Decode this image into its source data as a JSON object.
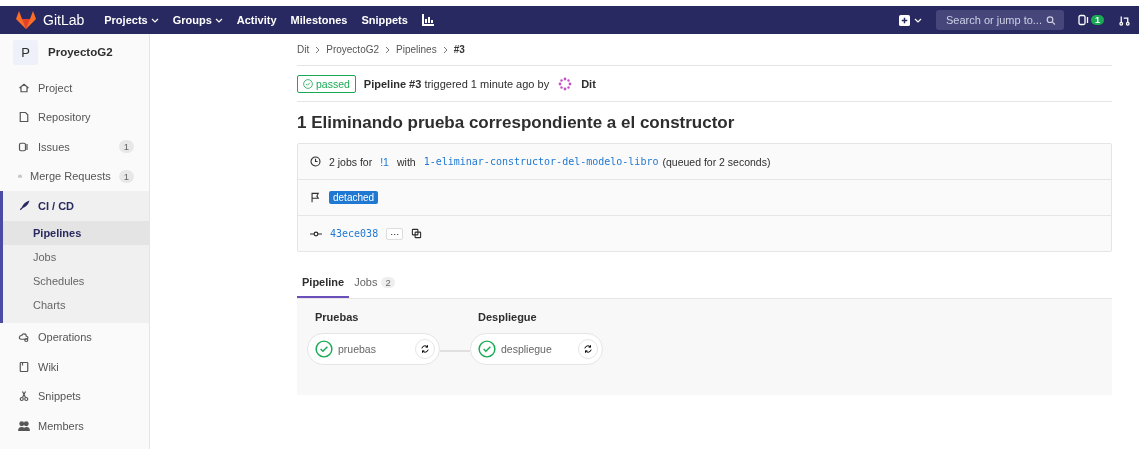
{
  "navbar": {
    "brand": "GitLab",
    "links": [
      {
        "label": "Projects",
        "dropdown": true
      },
      {
        "label": "Groups",
        "dropdown": true
      },
      {
        "label": "Activity",
        "dropdown": false
      },
      {
        "label": "Milestones",
        "dropdown": false
      },
      {
        "label": "Snippets",
        "dropdown": false
      }
    ],
    "search": {
      "placeholder": "Search or jump to..."
    },
    "issues_count": "1"
  },
  "sidebar": {
    "avatar": "P",
    "project": "ProyectoG2",
    "items": [
      {
        "label": "Project",
        "selected": false
      },
      {
        "label": "Repository",
        "selected": false
      },
      {
        "label": "Issues",
        "count": "1",
        "selected": false
      },
      {
        "label": "Merge Requests",
        "count": "1",
        "selected": false
      },
      {
        "label": "CI / CD",
        "selected": true,
        "expanded": true,
        "children": [
          {
            "label": "Pipelines",
            "selected": true
          },
          {
            "label": "Jobs",
            "selected": false
          },
          {
            "label": "Schedules",
            "selected": false
          },
          {
            "label": "Charts",
            "selected": false
          }
        ]
      },
      {
        "label": "Operations",
        "selected": false
      },
      {
        "label": "Wiki",
        "selected": false
      },
      {
        "label": "Snippets",
        "selected": false
      },
      {
        "label": "Members",
        "selected": false
      }
    ]
  },
  "breadcrumb": [
    "Dit",
    "ProyectoG2",
    "Pipelines",
    "#3"
  ],
  "header": {
    "status": "passed",
    "text": "**Pipeline #3** triggered 1 minute ago by",
    "user": "Dit"
  },
  "title": "1 Eliminando prueba correspondiente a el constructor",
  "info": {
    "jobs_text": "2 jobs for",
    "mr_link": "!1",
    "with": "with",
    "branch": "1-eliminar-constructor-del-modelo-libro",
    "queued": "(queued for 2 seconds)",
    "tag": "detached",
    "commit": "43ece038",
    "ellipsis": "···"
  },
  "tabs": [
    {
      "label": "Pipeline",
      "selected": true
    },
    {
      "label": "Jobs",
      "count": "2",
      "selected": false
    }
  ],
  "stages": [
    {
      "name": "Pruebas",
      "jobs": [
        {
          "name": "pruebas",
          "passed": true
        }
      ]
    },
    {
      "name": "Despliegue",
      "jobs": [
        {
          "name": "despliegue",
          "passed": true
        }
      ]
    }
  ]
}
